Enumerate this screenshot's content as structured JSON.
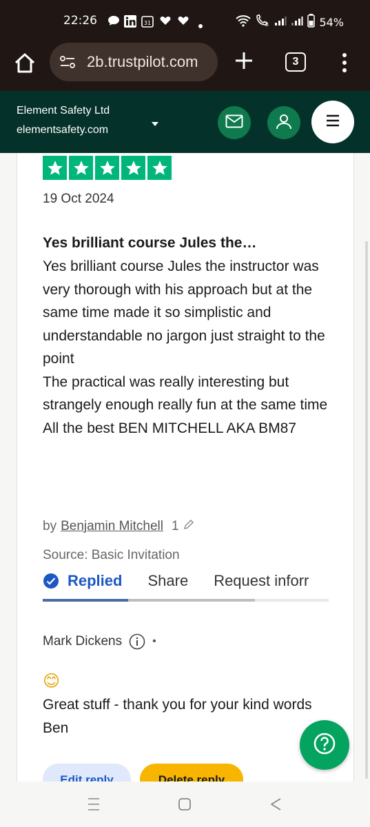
{
  "status_bar": {
    "time": "22:26",
    "battery": "54%",
    "calendar_day": "31",
    "icons": [
      "chat-bubble-icon",
      "linkedin-icon",
      "calendar-icon",
      "heart-icon",
      "heart-icon",
      "dot-icon",
      "wifi-icon",
      "wifi-call-icon",
      "signal-icon",
      "signal-icon",
      "battery-icon"
    ]
  },
  "browser": {
    "url": "2b.trustpilot.com",
    "tab_count": "3"
  },
  "site_header": {
    "company_name": "Element Safety Ltd",
    "company_domain": "elementsafety.com",
    "brand_color": "#04322a",
    "button_color": "#0f7a4d"
  },
  "review": {
    "rating_stars": 5,
    "star_color": "#00b67a",
    "date": "19 Oct 2024",
    "title": "Yes brilliant course Jules the…",
    "body_lines": [
      "Yes brilliant course Jules the instructor was very thorough with his approach but at the same time made it so simplistic and understandable no jargon just straight to the point",
      "The practical was really interesting but strangely enough really fun at the same time",
      "All the best BEN MITCHELL AKA BM87"
    ],
    "by_prefix": "by",
    "author": "Benjamin Mitchell",
    "author_review_count": "1",
    "source": "Source: Basic Invitation",
    "actions": {
      "replied": "Replied",
      "share": "Share",
      "request_info": "Request inforr"
    }
  },
  "reply": {
    "author": "Mark Dickens",
    "separator": "•",
    "emoji": "😊",
    "body": "Great stuff - thank you for your kind words Ben",
    "edit_label": "Edit reply",
    "delete_label": "Delete reply"
  },
  "help": {
    "label": "?"
  }
}
